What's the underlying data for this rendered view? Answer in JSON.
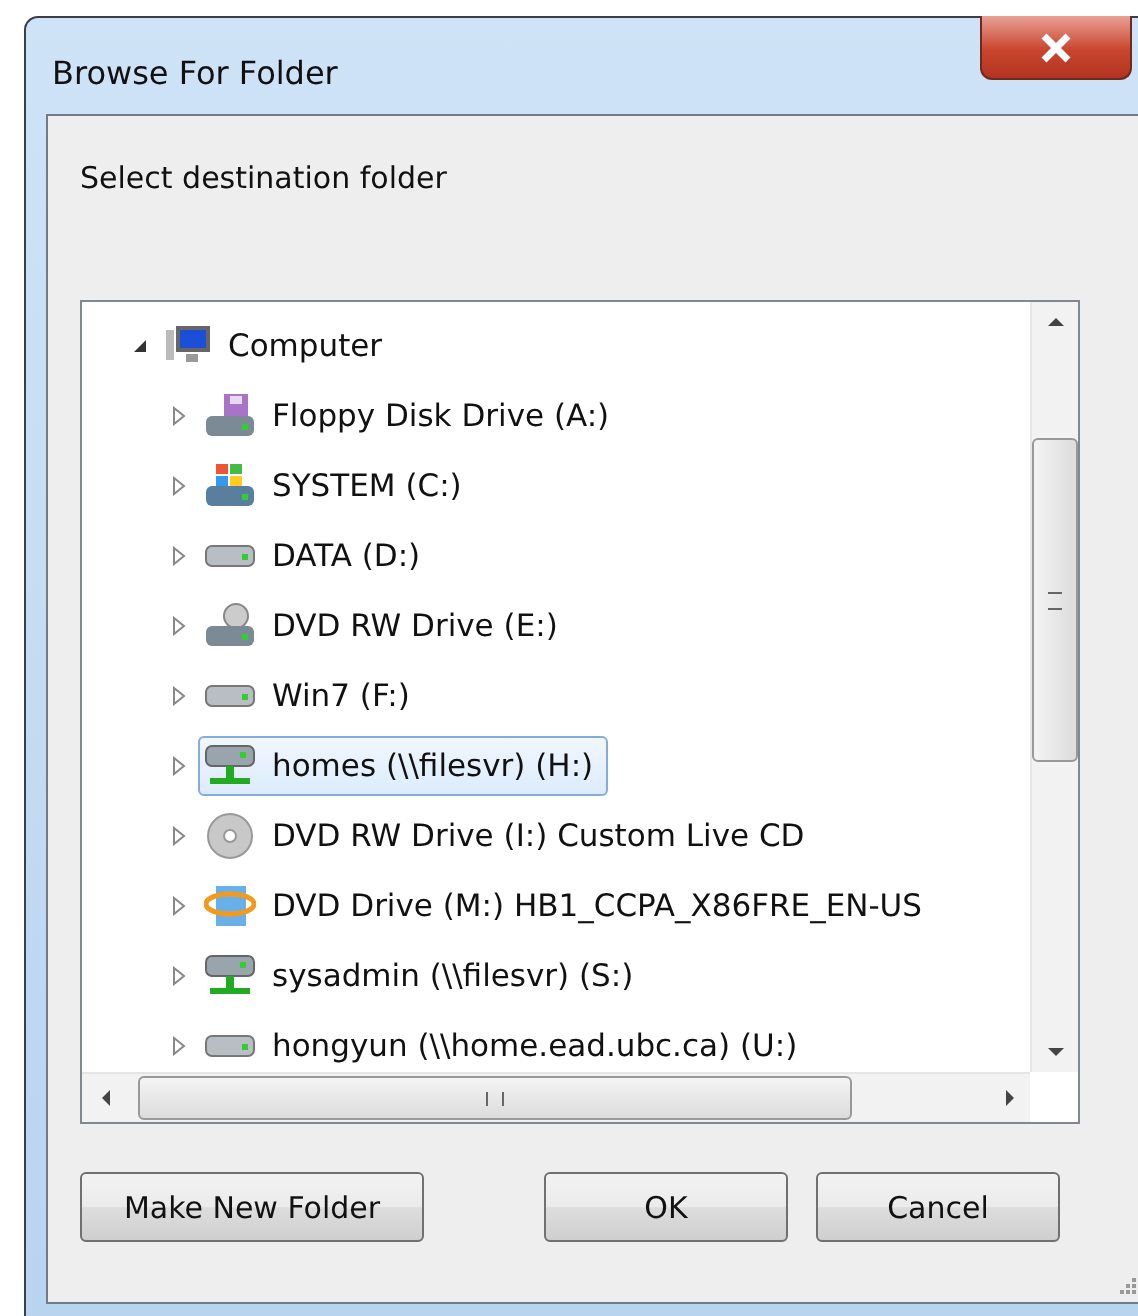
{
  "window": {
    "title": "Browse For Folder"
  },
  "description": "Select destination folder",
  "tree": [
    {
      "label": "Computer",
      "kind": "computer",
      "expanded": true,
      "selected": false,
      "children": [
        {
          "label": "Floppy Disk Drive (A:)",
          "kind": "floppy",
          "expanded": false,
          "selected": false
        },
        {
          "label": "SYSTEM (C:)",
          "kind": "system",
          "expanded": false,
          "selected": false
        },
        {
          "label": "DATA (D:)",
          "kind": "drive",
          "expanded": false,
          "selected": false
        },
        {
          "label": "DVD RW Drive (E:)",
          "kind": "dvdrw",
          "expanded": false,
          "selected": false
        },
        {
          "label": "Win7 (F:)",
          "kind": "drive",
          "expanded": false,
          "selected": false
        },
        {
          "label": "homes (\\\\filesvr) (H:)",
          "kind": "network",
          "expanded": false,
          "selected": true
        },
        {
          "label": "DVD RW Drive (I:) Custom Live CD",
          "kind": "disc",
          "expanded": false,
          "selected": false
        },
        {
          "label": "DVD Drive (M:) HB1_CCPA_X86FRE_EN-US",
          "kind": "setup",
          "expanded": false,
          "selected": false
        },
        {
          "label": "sysadmin (\\\\filesvr) (S:)",
          "kind": "network",
          "expanded": false,
          "selected": false
        },
        {
          "label": "hongyun (\\\\home.ead.ubc.ca) (U:)",
          "kind": "drive",
          "expanded": false,
          "selected": false
        }
      ]
    }
  ],
  "buttons": [
    {
      "label": "Make New Folder",
      "kind": "left"
    },
    {
      "label": "OK",
      "kind": "right"
    },
    {
      "label": "Cancel",
      "kind": "right"
    }
  ]
}
